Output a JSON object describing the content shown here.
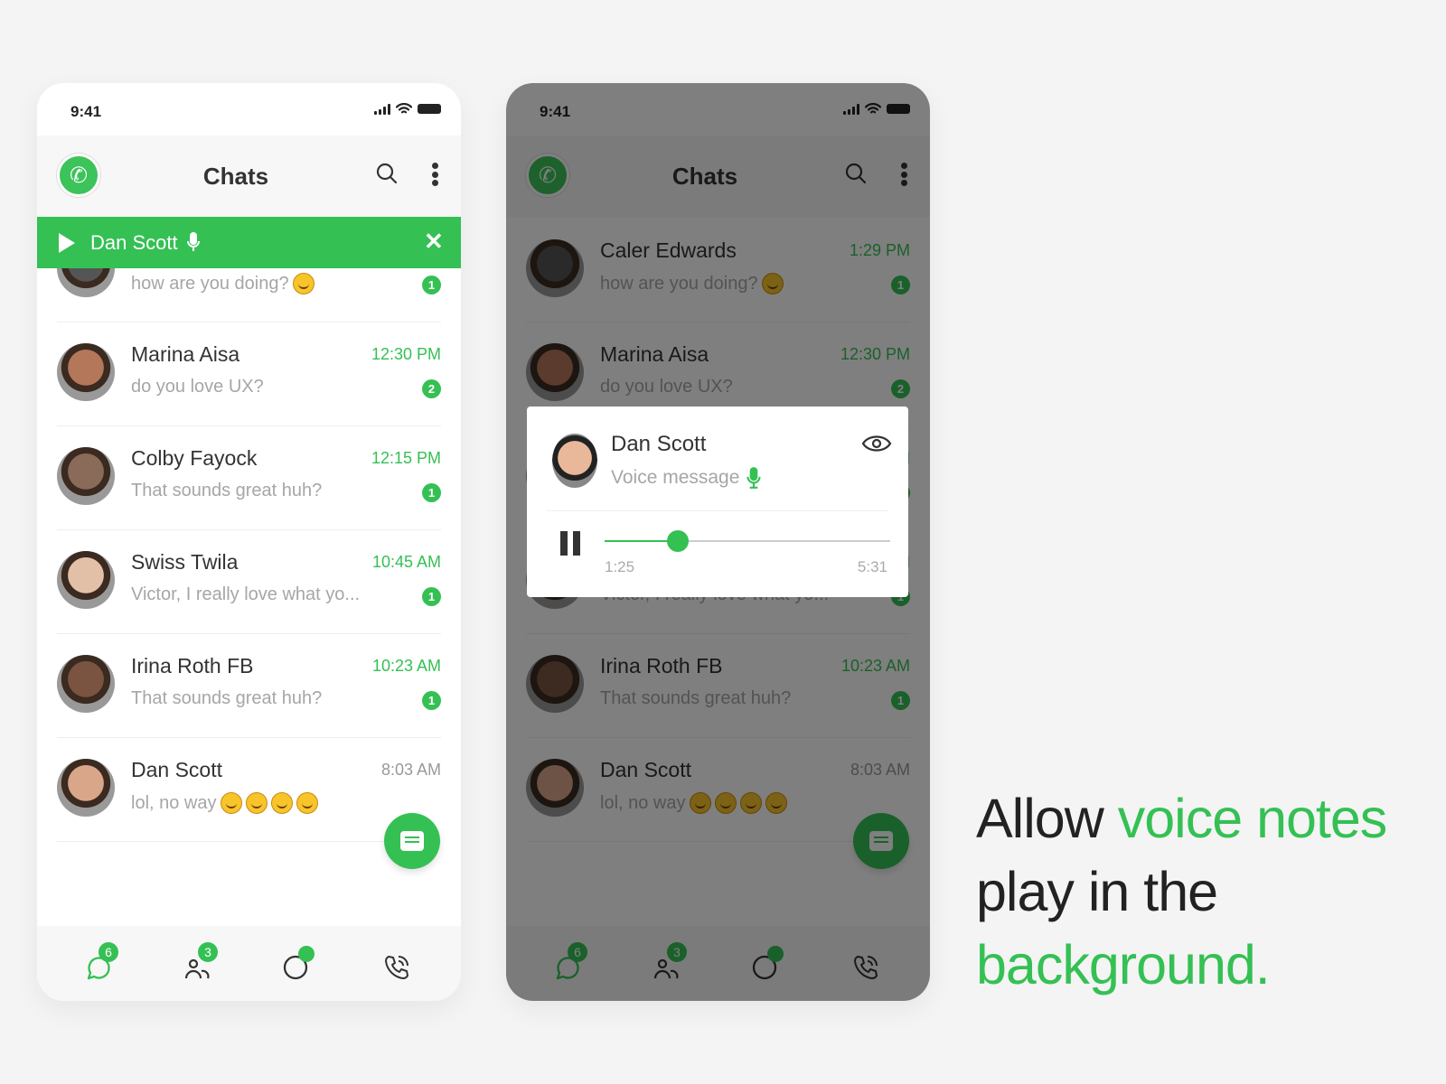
{
  "status_bar": {
    "time": "9:41"
  },
  "header": {
    "title": "Chats"
  },
  "now_playing": {
    "contact": "Dan Scott",
    "close_label": "✕"
  },
  "chats": [
    {
      "name": "Caler Edwards",
      "time": "1:29 PM",
      "message": "how are you doing?",
      "emojis": [
        "wink"
      ],
      "unread": "1",
      "time_highlight": true,
      "avatar_color": "#555"
    },
    {
      "name": "Marina Aisa",
      "time": "12:30 PM",
      "message": "do you love UX?",
      "emojis": [],
      "unread": "2",
      "time_highlight": true,
      "avatar_color": "#b5775a"
    },
    {
      "name": "Colby Fayock",
      "time": "12:15 PM",
      "message": "That sounds great huh?",
      "emojis": [],
      "unread": "1",
      "time_highlight": true,
      "avatar_color": "#8a6a58"
    },
    {
      "name": "Swiss Twila",
      "time": "10:45 AM",
      "message": "Victor, I really love what yo...",
      "emojis": [],
      "unread": "1",
      "time_highlight": true,
      "avatar_color": "#e2c0a8"
    },
    {
      "name": "Irina Roth FB",
      "time": "10:23 AM",
      "message": "That sounds great huh?",
      "emojis": [],
      "unread": "1",
      "time_highlight": true,
      "avatar_color": "#7a5440"
    },
    {
      "name": "Dan Scott",
      "time": "8:03 AM",
      "message": "lol, no way",
      "emojis": [
        "joy",
        "joy",
        "smile",
        "joy"
      ],
      "unread": null,
      "time_highlight": false,
      "avatar_color": "#d9a68a"
    }
  ],
  "bottom_nav": [
    {
      "icon": "chat-bubble-icon",
      "badge": "6",
      "active": true
    },
    {
      "icon": "contacts-icon",
      "badge": "3",
      "active": false
    },
    {
      "icon": "status-icon",
      "badge": "",
      "active": false
    },
    {
      "icon": "calls-icon",
      "badge": null,
      "active": false
    }
  ],
  "voice_dialog": {
    "contact": "Dan Scott",
    "subtitle": "Voice message",
    "elapsed": "1:25",
    "duration": "5:31",
    "progress": 0.257
  },
  "tagline": {
    "part1": "Allow ",
    "highlight1": "voice notes",
    "part2": "play in the",
    "highlight2": "background."
  },
  "colors": {
    "accent": "#35c054",
    "background": "#f4f4f4"
  }
}
